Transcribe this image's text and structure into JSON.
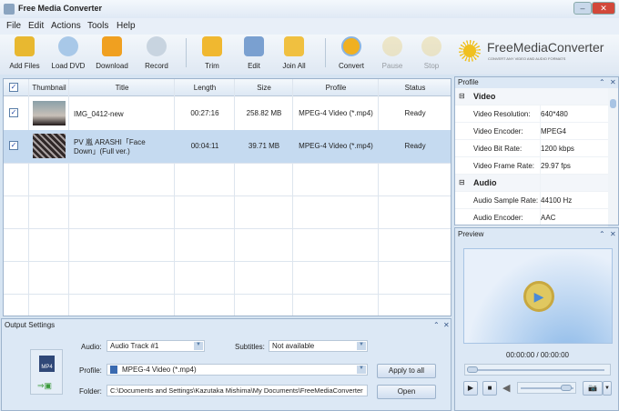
{
  "window": {
    "title": "Free Media Converter"
  },
  "menu": [
    "File",
    "Edit",
    "Actions",
    "Tools",
    "Help"
  ],
  "toolbar": [
    {
      "label": "Add Files",
      "icon": "add-files-icon"
    },
    {
      "label": "Load DVD",
      "icon": "load-dvd-icon"
    },
    {
      "label": "Download",
      "icon": "download-icon"
    },
    {
      "label": "Record",
      "icon": "record-icon"
    },
    {
      "label": "Trim",
      "icon": "trim-icon"
    },
    {
      "label": "Edit",
      "icon": "edit-icon"
    },
    {
      "label": "Join All",
      "icon": "join-icon"
    },
    {
      "label": "Convert",
      "icon": "convert-icon"
    },
    {
      "label": "Pause",
      "icon": "pause-icon"
    },
    {
      "label": "Stop",
      "icon": "stop-icon"
    }
  ],
  "logo": {
    "name": "FreeMediaConverter",
    "tagline": "CONVERT ANY VIDEO AND AUDIO FORMATS"
  },
  "grid": {
    "columns": [
      "Thumbnail",
      "Title",
      "Length",
      "Size",
      "Profile",
      "Status"
    ],
    "rows": [
      {
        "title": "IMG_0412-new",
        "length": "00:27:16",
        "size": "258.82 MB",
        "profile": "MPEG-4 Video (*.mp4)",
        "status": "Ready",
        "checked": true
      },
      {
        "title": "PV 嵐 ARASHI「Face Down」(Full ver.)",
        "length": "00:04:11",
        "size": "39.71 MB",
        "profile": "MPEG-4 Video (*.mp4)",
        "status": "Ready",
        "checked": true
      }
    ]
  },
  "output": {
    "title": "Output Settings",
    "audio_label": "Audio:",
    "audio": "Audio Track #1",
    "subtitles_label": "Subtitles:",
    "subtitles": "Not available",
    "profile_label": "Profile:",
    "profile": "MPEG-4 Video (*.mp4)",
    "folder_label": "Folder:",
    "folder": "C:\\Documents and Settings\\Kazutaka Mishima\\My Documents\\FreeMediaConverter",
    "apply": "Apply to all",
    "open": "Open",
    "format_badge": "MP4"
  },
  "profile": {
    "title": "Profile",
    "video": "Video",
    "audio": "Audio",
    "props": [
      {
        "k": "Video Resolution:",
        "v": "640*480"
      },
      {
        "k": "Video Encoder:",
        "v": "MPEG4"
      },
      {
        "k": "Video Bit Rate:",
        "v": "1200 kbps"
      },
      {
        "k": "Video Frame Rate:",
        "v": "29.97 fps"
      },
      {
        "k": "Audio Sample Rate:",
        "v": "44100 Hz"
      },
      {
        "k": "Audio Encoder:",
        "v": "AAC"
      }
    ]
  },
  "preview": {
    "title": "Preview",
    "time": "00:00:00 / 00:00:00",
    "seek": 0,
    "volume": 0.9
  }
}
